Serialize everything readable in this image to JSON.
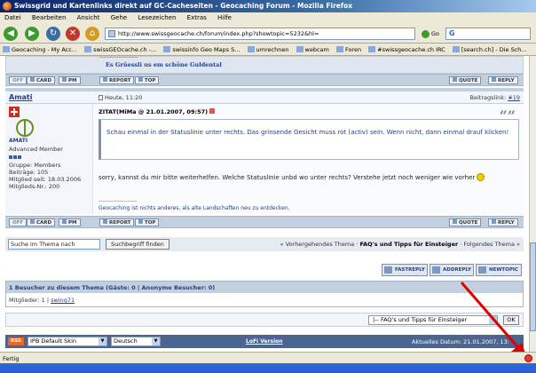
{
  "window": {
    "title": "Swissgrid und Kartenlinks direkt auf GC-Cacheseiten - Geocaching Forum - Mozilla Firefox"
  },
  "menu": [
    "Datei",
    "Bearbeiten",
    "Ansicht",
    "Gehe",
    "Lesezeichen",
    "Extras",
    "Hilfe"
  ],
  "nav": {
    "url": "http://www.swissgeocache.ch/forum/index.php?showtopic=5232&hl=",
    "go_label": "Go",
    "search_engine": "G"
  },
  "bookmarks": [
    "Geocaching - My Acc...",
    "swissGEOcache.ch -...",
    "swissinfo Geo Maps S...",
    "umrechnen",
    "webcam",
    "Foren",
    "#swissgeocache.ch IRC",
    "[search.ch] - Die Sch..."
  ],
  "prev_post": {
    "signature_rule": "--------------------",
    "signature": "Es Grüessli us em schöne Guldental",
    "buttons": {
      "off": "OFF",
      "card": "CARD",
      "pm": "PM",
      "report": "REPORT",
      "top": "TOP",
      "quote": "QUOTE",
      "reply": "REPLY"
    }
  },
  "post": {
    "author": "Amati",
    "date": "Heute, 11:20",
    "link_label": "Beitragslink:",
    "link_id": "#19",
    "avatar_text": "AMATI",
    "rank": "Advanced Member",
    "stats": [
      "Gruppe: Members",
      "Beiträge: 105",
      "Mitglied seit: 18.03.2006",
      "Mitglieds-Nr.: 200"
    ],
    "quote_header": "ZITAT(MiMa @ 21.01.2007, 09:57)",
    "quote_text": "Schau einmal in der Statuslinie unter rechts. Das grinsende Gesicht muss rot (activ) sein. Wenn nicht, dann einmal drauf klicken!",
    "reply_text": "sorry, kannst du mir bitte weiterhelfen. Welche Statuslinie unbd wo unter rechts? Verstehe jetzt noch weniger wie vorher",
    "signature_rule": "--------------------",
    "signature": "Geocaching ist nichts anderes, als alte Landschaften neu zu entdecken.",
    "buttons": {
      "off": "OFF",
      "card": "CARD",
      "pm": "PM",
      "report": "REPORT",
      "top": "TOP",
      "quote": "QUOTE",
      "reply": "REPLY"
    }
  },
  "topic_nav": {
    "search_value": "Suche im Thema nach",
    "search_button": "Suchbegriff finden",
    "prev": "« Vorhergehendes Thema",
    "sep": "·",
    "current": "FAQ's und Tipps für Einsteiger",
    "next": "Folgendes Thema »"
  },
  "actions": {
    "fastreply": "FASTREPLY",
    "addreply": "ADDREPLY",
    "newtopic": "NEWTOPIC"
  },
  "active_users": {
    "header": "1 Besucher zu diesem Thema (Gäste: 0 | Anonyme Besucher: 0)",
    "members_label": "Mitglieder: 1 |",
    "member": "swing71"
  },
  "jump": {
    "selected": "|-- FAQ's und Tipps für Einsteiger",
    "ok": "OK"
  },
  "footer": {
    "rss": "RSS",
    "skin": "IPB Default Skin",
    "lang": "Deutsch",
    "lofi": "LoFi Version",
    "date": "Aktuelles Datum: 21.01.2007, 13:"
  },
  "status": {
    "text": "Fertig"
  }
}
